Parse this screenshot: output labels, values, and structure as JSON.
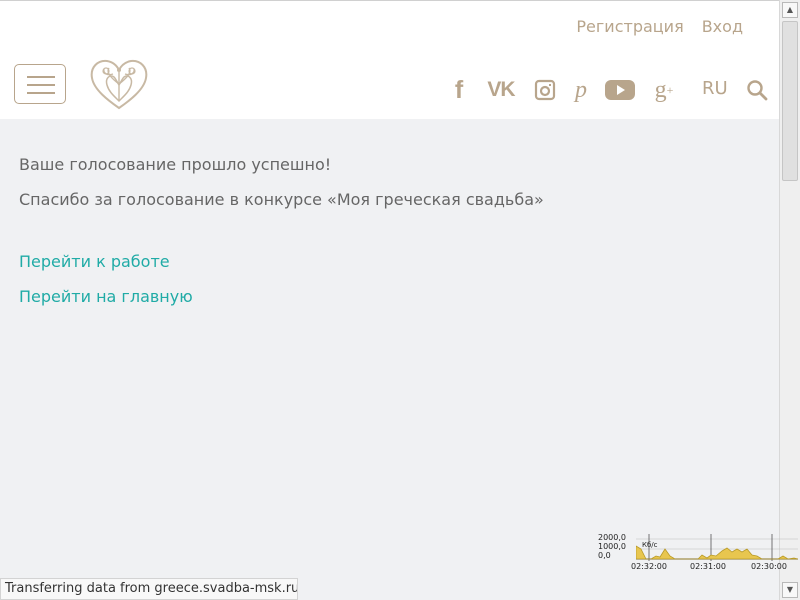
{
  "header": {
    "register_label": "Регистрация",
    "login_label": "Вход",
    "language": "RU",
    "accent_color": "#b8a58c",
    "menu_icon": "hamburger-menu-icon",
    "logo_icon": "ornamental-heart-logo",
    "social_icons": [
      "facebook-icon",
      "vk-icon",
      "instagram-icon",
      "pinterest-icon",
      "youtube-icon",
      "google-plus-icon"
    ],
    "search_icon": "search-icon"
  },
  "main": {
    "success_message": "Ваше голосование прошло успешно!",
    "thanks_message": "Спасибо за голосование в конкурсе «Моя греческая свадьба»",
    "work_link": "Перейти к работе",
    "home_link": "Перейти на главную",
    "text_color": "#666666",
    "link_color": "#20aba6",
    "background_color": "#f0f1f3"
  },
  "browser": {
    "status_text": "Transferring data from greece.svadba-msk.ru...",
    "scrollbar_up_icon": "scroll-up-arrow-icon",
    "scrollbar_down_icon": "scroll-down-arrow-icon"
  },
  "speed_widget": {
    "unit": "Кб/с",
    "y_labels": [
      "2000,0",
      "1000,0",
      "0,0"
    ],
    "time_labels": [
      "02:32:00",
      "02:31:00",
      "02:30:00"
    ],
    "fill_color": "#e8c64f"
  }
}
